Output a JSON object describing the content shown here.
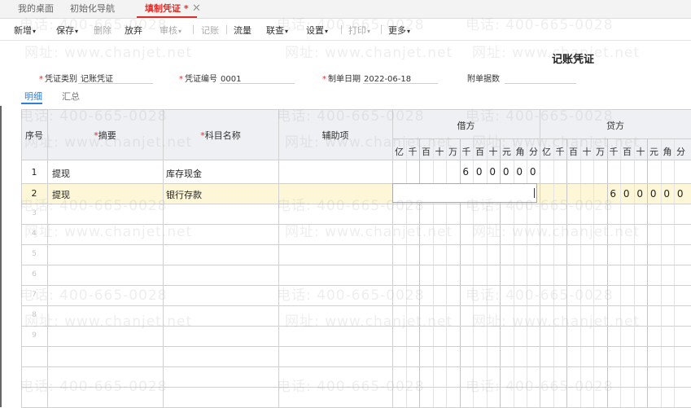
{
  "tabs": [
    {
      "label": "我的桌面"
    },
    {
      "label": "初始化导航"
    },
    {
      "label": "填制凭证 *"
    }
  ],
  "toolbar": {
    "items": [
      {
        "label": "新增"
      },
      {
        "label": "保存"
      },
      {
        "label": "删除"
      },
      {
        "label": "放弃"
      },
      {
        "label": "审核"
      },
      {
        "label": "记账"
      },
      {
        "label": "流量"
      },
      {
        "label": "联查"
      },
      {
        "label": "设置"
      },
      {
        "label": "打印"
      },
      {
        "label": "更多"
      }
    ]
  },
  "voucher": {
    "title": "记账凭证",
    "category_label": "凭证类别",
    "category_value": "记账凭证",
    "number_label": "凭证编号",
    "number_value": "0001",
    "date_label": "制单日期",
    "date_value": "2022-06-18",
    "attachments_label": "附单据数",
    "attachments_value": ""
  },
  "subtabs": [
    {
      "label": "明细"
    },
    {
      "label": "汇总"
    }
  ],
  "table": {
    "headers": {
      "seq": "序号",
      "summary": "摘要",
      "account": "科目名称",
      "aux": "辅助项",
      "debit": "借方",
      "credit": "贷方"
    },
    "digit_units": [
      "亿",
      "千",
      "百",
      "十",
      "万",
      "千",
      "百",
      "十",
      "元",
      "角",
      "分"
    ],
    "rows": [
      {
        "no": "1",
        "summary": "提现",
        "account": "库存现金",
        "aux": "",
        "debit": [
          "6",
          "0",
          "0",
          "0",
          "0",
          "0"
        ],
        "credit": []
      },
      {
        "no": "2",
        "summary": "提现",
        "account": "银行存款",
        "aux": "",
        "debit": [],
        "credit": [
          "6",
          "0",
          "0",
          "0",
          "0",
          "0"
        ]
      }
    ],
    "empty_rows": [
      "3",
      "4",
      "5",
      "6",
      "7",
      "8",
      "9"
    ]
  },
  "watermark": {
    "phone": "电话: 400-665-0028",
    "site": "网址: www.chanjet.net"
  }
}
